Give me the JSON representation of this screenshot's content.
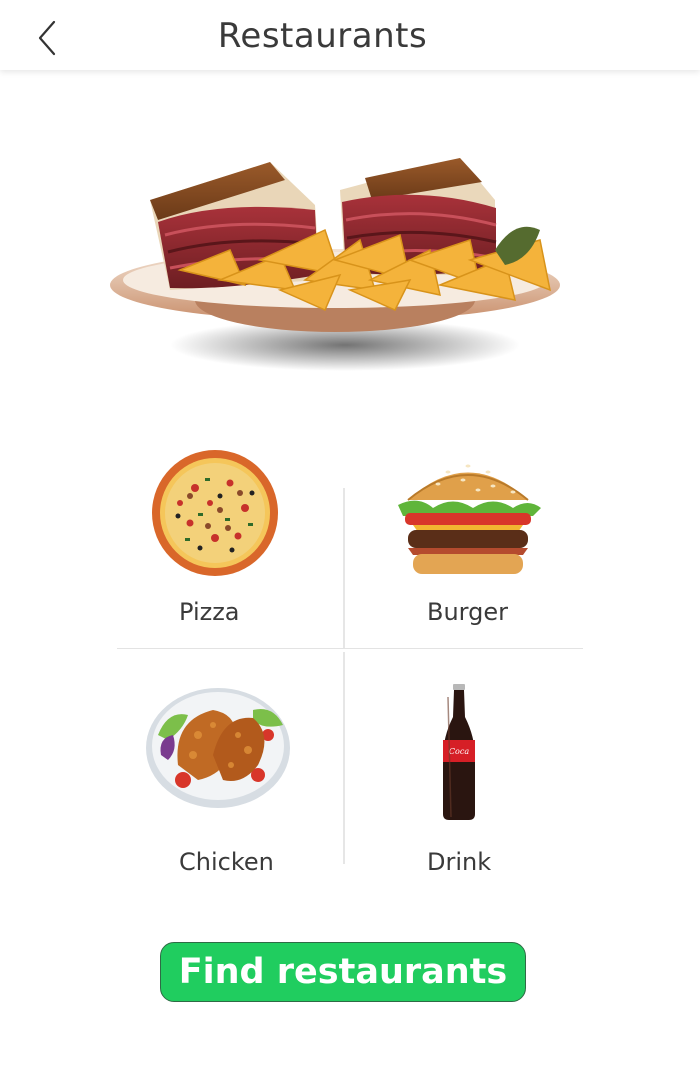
{
  "header": {
    "title": "Restaurants",
    "back_icon": "chevron-left-icon"
  },
  "hero": {
    "image": "sandwich-chips-plate"
  },
  "categories": [
    {
      "label": "Pizza",
      "icon": "pizza-icon"
    },
    {
      "label": "Burger",
      "icon": "burger-icon"
    },
    {
      "label": "Chicken",
      "icon": "fried-chicken-icon"
    },
    {
      "label": "Drink",
      "icon": "cola-bottle-icon"
    }
  ],
  "actions": {
    "find_label": "Find restaurants"
  },
  "colors": {
    "accent": "#20cd5f",
    "text": "#3a3a3a",
    "divider": "#e6e6e6"
  }
}
